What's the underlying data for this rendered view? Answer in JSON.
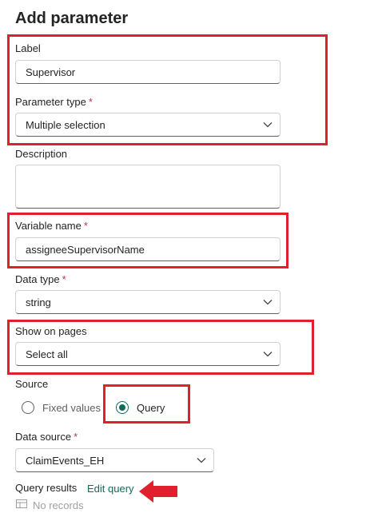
{
  "title": "Add parameter",
  "label": {
    "label": "Label",
    "value": "Supervisor"
  },
  "parameter_type": {
    "label": "Parameter type",
    "required": "*",
    "value": "Multiple selection",
    "icon": "chevron-down-icon"
  },
  "description": {
    "label": "Description",
    "value": ""
  },
  "variable_name": {
    "label": "Variable name",
    "required": "*",
    "value": "assigneeSupervisorName"
  },
  "data_type": {
    "label": "Data type",
    "required": "*",
    "value": "string",
    "icon": "chevron-down-icon"
  },
  "show_on_pages": {
    "label": "Show on pages",
    "value": "Select all",
    "icon": "chevron-down-icon"
  },
  "source": {
    "label": "Source",
    "options": [
      {
        "label": "Fixed values",
        "selected": false
      },
      {
        "label": "Query",
        "selected": true
      }
    ]
  },
  "data_source": {
    "label": "Data source",
    "required": "*",
    "value": "ClaimEvents_EH",
    "icon": "chevron-down-icon"
  },
  "query_results": {
    "label": "Query results",
    "edit_link": "Edit query",
    "empty_text": "No records",
    "icon": "table-icon"
  },
  "colors": {
    "highlight": "#e0202c",
    "accent": "#0f6c5d",
    "required": "#c4314b",
    "arrow": "#e0202c"
  }
}
